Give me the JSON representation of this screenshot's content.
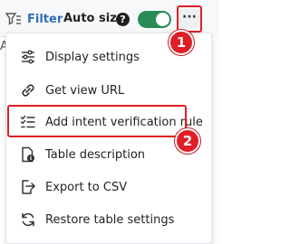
{
  "toolbar": {
    "filter_label": "Filter",
    "autosize_label": "Auto size",
    "help_glyph": "?",
    "more_glyph": "···",
    "left_edge_char": "A"
  },
  "menu": {
    "items": [
      {
        "label": "Display settings",
        "icon": "sliders-icon"
      },
      {
        "label": "Get view URL",
        "icon": "link-icon"
      },
      {
        "label": "Add intent verification rule",
        "icon": "checklist-icon"
      },
      {
        "label": "Table description",
        "icon": "document-info-icon"
      },
      {
        "label": "Export to CSV",
        "icon": "export-icon"
      },
      {
        "label": "Restore table settings",
        "icon": "restore-icon"
      }
    ]
  },
  "annotations": {
    "badge_1": "1",
    "badge_2": "2",
    "color": "#e01e26"
  },
  "colors": {
    "accent": "#2f6fb5",
    "toggle_on": "#2a8c55"
  }
}
